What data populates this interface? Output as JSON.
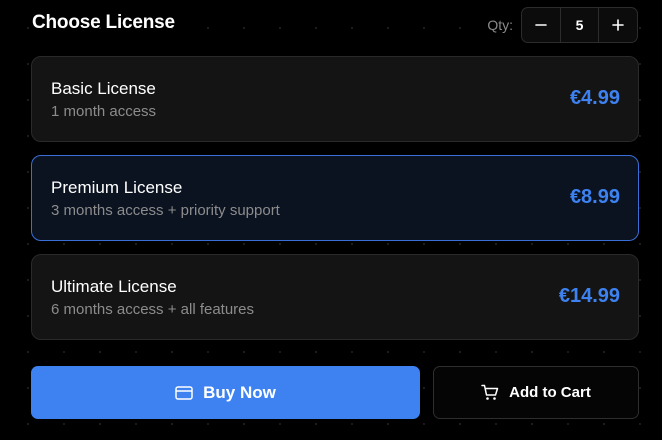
{
  "header": {
    "title": "Choose License",
    "qty_label": "Qty:",
    "quantity": "5",
    "decrement_icon": "minus-icon",
    "increment_icon": "plus-icon"
  },
  "licenses": [
    {
      "name": "Basic License",
      "description": "1 month access",
      "price": "€4.99",
      "selected": false
    },
    {
      "name": "Premium License",
      "description": "3 months access + priority support",
      "price": "€8.99",
      "selected": true
    },
    {
      "name": "Ultimate License",
      "description": "6 months access + all features",
      "price": "€14.99",
      "selected": false
    }
  ],
  "actions": {
    "buy_label": "Buy Now",
    "buy_icon": "credit-card-icon",
    "cart_label": "Add to Cart",
    "cart_icon": "cart-icon"
  },
  "colors": {
    "accent": "#3d82f0",
    "selected_border": "#3b6fd8",
    "background": "#000000",
    "card": "#141414"
  }
}
